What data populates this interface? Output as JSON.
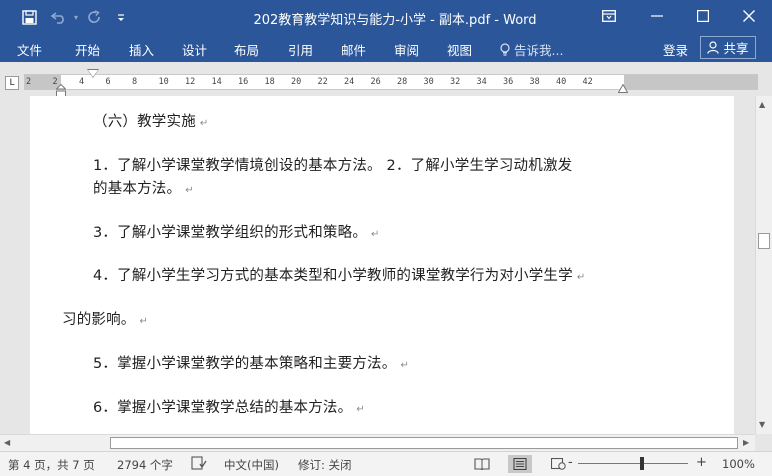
{
  "window": {
    "title": "202教育教学知识与能力-小学 - 副本.pdf - Word",
    "quick_access": {
      "save_icon": "save-icon",
      "undo_icon": "undo-icon",
      "redo_icon": "redo-icon",
      "customize_icon": "customize-qat-icon"
    },
    "controls": {
      "ribbon_display_icon": "ribbon-display-options-icon",
      "minimize_icon": "minimize-icon",
      "maximize_icon": "maximize-icon",
      "close_icon": "close-icon"
    }
  },
  "ribbon": {
    "tabs": [
      "文件",
      "开始",
      "插入",
      "设计",
      "布局",
      "引用",
      "邮件",
      "审阅",
      "视图"
    ],
    "tell_me": "告诉我...",
    "login": "登录",
    "share": "共享",
    "accent": "#2b579a"
  },
  "ruler": {
    "tab_selector": "L",
    "ticks": [
      "2",
      "2",
      "4",
      "6",
      "8",
      "10",
      "12",
      "14",
      "16",
      "18",
      "20",
      "22",
      "24",
      "26",
      "28",
      "30",
      "32",
      "34",
      "36",
      "38",
      "40",
      "42"
    ]
  },
  "document": {
    "paragraphs": [
      {
        "text": "（六）教学实施",
        "mark": "↵"
      },
      {
        "text": "1．了解小学课堂教学情境创设的基本方法。 2．了解小学生学习动机激发",
        "mark": ""
      },
      {
        "text": "的基本方法。",
        "mark": "↵"
      },
      {
        "text": "3．了解小学课堂教学组织的形式和策略。",
        "mark": "↵"
      },
      {
        "text": "4．了解小学生学习方式的基本类型和小学教师的课堂教学行为对小学生学",
        "mark": "↵"
      },
      {
        "text": "习的影响。",
        "mark": "↵"
      },
      {
        "text": "5．掌握小学课堂教学的基本策略和主要方法。",
        "mark": "↵"
      },
      {
        "text": "6．掌握小学课堂教学总结的基本方法。",
        "mark": "↵"
      }
    ]
  },
  "status": {
    "page": "第 4 页，共 7 页",
    "words": "2794 个字",
    "proofing_icon": "proofing-icon",
    "language": "中文(中国)",
    "track_changes": "修订: 关闭",
    "zoom_minus": "-",
    "zoom_plus": "+",
    "zoom": "100%",
    "zoom_level_percent": 100
  }
}
